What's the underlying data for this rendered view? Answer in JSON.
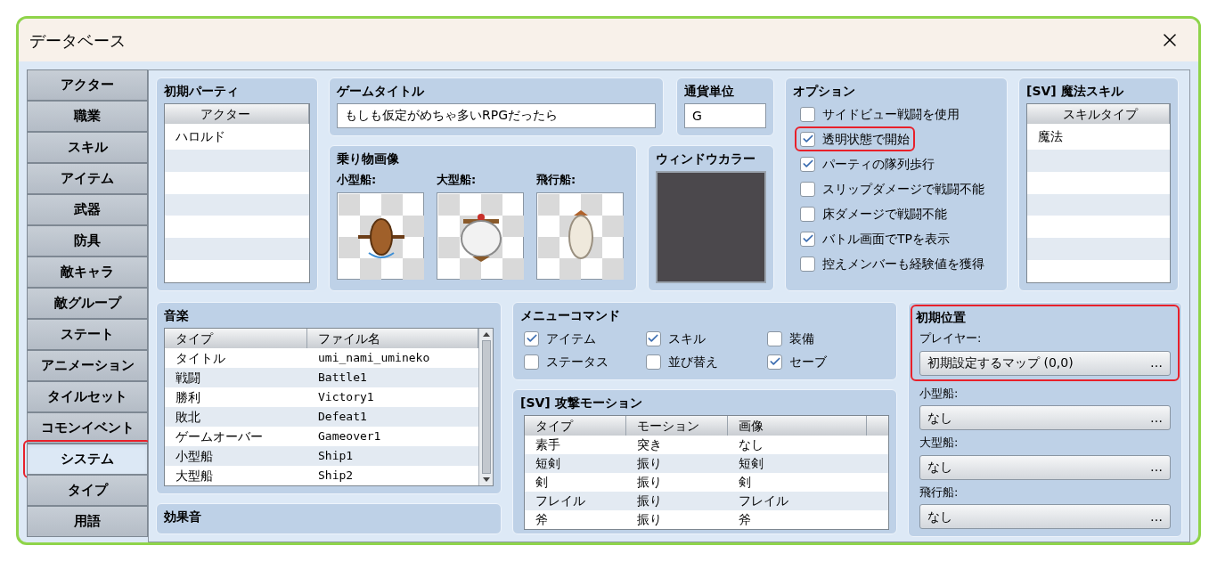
{
  "window": {
    "title": "データベース"
  },
  "sidebar": {
    "items": [
      {
        "label": "アクター",
        "selected": false,
        "highlighted": false
      },
      {
        "label": "職業",
        "selected": false,
        "highlighted": false
      },
      {
        "label": "スキル",
        "selected": false,
        "highlighted": false
      },
      {
        "label": "アイテム",
        "selected": false,
        "highlighted": false
      },
      {
        "label": "武器",
        "selected": false,
        "highlighted": false
      },
      {
        "label": "防具",
        "selected": false,
        "highlighted": false
      },
      {
        "label": "敵キャラ",
        "selected": false,
        "highlighted": false
      },
      {
        "label": "敵グループ",
        "selected": false,
        "highlighted": false
      },
      {
        "label": "ステート",
        "selected": false,
        "highlighted": false
      },
      {
        "label": "アニメーション",
        "selected": false,
        "highlighted": false
      },
      {
        "label": "タイルセット",
        "selected": false,
        "highlighted": false
      },
      {
        "label": "コモンイベント",
        "selected": false,
        "highlighted": false
      },
      {
        "label": "システム",
        "selected": true,
        "highlighted": true
      },
      {
        "label": "タイプ",
        "selected": false,
        "highlighted": false
      },
      {
        "label": "用語",
        "selected": false,
        "highlighted": false
      }
    ]
  },
  "initial_party": {
    "title": "初期パーティ",
    "column": "アクター",
    "rows": [
      "ハロルド"
    ]
  },
  "game_title": {
    "title": "ゲームタイトル",
    "value": "もしも仮定がめちゃ多いRPGだったら"
  },
  "currency": {
    "title": "通貨単位",
    "value": "G"
  },
  "vehicle_images": {
    "title": "乗り物画像",
    "items": [
      {
        "label": "小型船:",
        "kind": "boat"
      },
      {
        "label": "大型船:",
        "kind": "ship"
      },
      {
        "label": "飛行船:",
        "kind": "airship"
      }
    ]
  },
  "window_color": {
    "title": "ウィンドウカラー"
  },
  "options": {
    "title": "オプション",
    "items": [
      {
        "label": "サイドビュー戦闘を使用",
        "checked": false,
        "highlighted": false
      },
      {
        "label": "透明状態で開始",
        "checked": true,
        "highlighted": true
      },
      {
        "label": "パーティの隊列歩行",
        "checked": true,
        "highlighted": false
      },
      {
        "label": "スリップダメージで戦闘不能",
        "checked": false,
        "highlighted": false
      },
      {
        "label": "床ダメージで戦闘不能",
        "checked": false,
        "highlighted": false
      },
      {
        "label": "バトル画面でTPを表示",
        "checked": true,
        "highlighted": false
      },
      {
        "label": "控えメンバーも経験値を獲得",
        "checked": false,
        "highlighted": false
      }
    ]
  },
  "sv_magic_skill": {
    "title": "[SV] 魔法スキル",
    "column": "スキルタイプ",
    "rows": [
      "魔法"
    ]
  },
  "music": {
    "title": "音楽",
    "columns": [
      "タイプ",
      "ファイル名"
    ],
    "rows": [
      [
        "タイトル",
        "umi_nami_umineko"
      ],
      [
        "戦闘",
        "Battle1"
      ],
      [
        "勝利",
        "Victory1"
      ],
      [
        "敗北",
        "Defeat1"
      ],
      [
        "ゲームオーバー",
        "Gameover1"
      ],
      [
        "小型船",
        "Ship1"
      ],
      [
        "大型船",
        "Ship2"
      ]
    ]
  },
  "sound_effects": {
    "title": "効果音"
  },
  "menu_commands": {
    "title": "メニューコマンド",
    "items": [
      {
        "label": "アイテム",
        "checked": true
      },
      {
        "label": "スキル",
        "checked": true
      },
      {
        "label": "装備",
        "checked": false
      },
      {
        "label": "ステータス",
        "checked": false
      },
      {
        "label": "並び替え",
        "checked": false
      },
      {
        "label": "セーブ",
        "checked": true
      }
    ]
  },
  "sv_attack_motion": {
    "title": "[SV] 攻撃モーション",
    "columns": [
      "タイプ",
      "モーション",
      "画像"
    ],
    "rows": [
      [
        "素手",
        "突き",
        "なし"
      ],
      [
        "短剣",
        "振り",
        "短剣"
      ],
      [
        "剣",
        "振り",
        "剣"
      ],
      [
        "フレイル",
        "振り",
        "フレイル"
      ],
      [
        "斧",
        "振り",
        "斧"
      ]
    ]
  },
  "start_position": {
    "title": "初期位置",
    "highlighted": true,
    "fields": [
      {
        "label": "プレイヤー:",
        "value": "初期設定するマップ (0,0)",
        "more": "…"
      },
      {
        "label": "小型船:",
        "value": "なし",
        "more": "…"
      },
      {
        "label": "大型船:",
        "value": "なし",
        "more": "…"
      },
      {
        "label": "飛行船:",
        "value": "なし",
        "more": "…"
      }
    ]
  }
}
